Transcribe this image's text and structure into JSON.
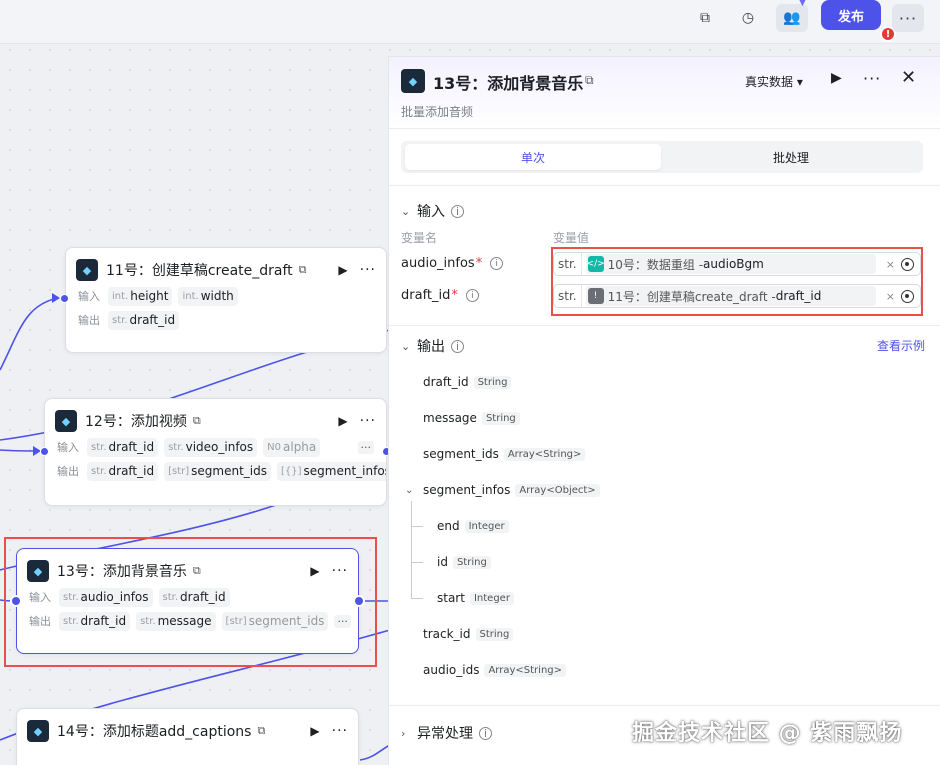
{
  "topbar": {
    "icons": [
      "layers-icon",
      "history-icon",
      "users-icon",
      "more-icon"
    ],
    "publish_label": "发布",
    "alert_label": "!"
  },
  "nodes": [
    {
      "title": "11号：创建草稿create_draft",
      "icon": "node-icon",
      "inputs_label": "输入",
      "outputs_label": "输出",
      "inputs": [
        {
          "type": "int.",
          "name": "height"
        },
        {
          "type": "int.",
          "name": "width"
        }
      ],
      "outputs": [
        {
          "type": "str.",
          "name": "draft_id"
        }
      ]
    },
    {
      "title": "12号：添加视频",
      "icon": "node-icon",
      "inputs_label": "输入",
      "outputs_label": "输出",
      "inputs": [
        {
          "type": "str.",
          "name": "draft_id"
        },
        {
          "type": "str.",
          "name": "video_infos"
        },
        {
          "type": "N0",
          "name": "alpha"
        }
      ],
      "more": "···",
      "outputs": [
        {
          "type": "str.",
          "name": "draft_id"
        },
        {
          "type": "[str]",
          "name": "segment_ids"
        },
        {
          "type": "[{}]",
          "name": "segment_infos"
        }
      ]
    },
    {
      "title": "13号：添加背景音乐",
      "icon": "node-icon",
      "inputs_label": "输入",
      "outputs_label": "输出",
      "inputs": [
        {
          "type": "str.",
          "name": "audio_infos"
        },
        {
          "type": "str.",
          "name": "draft_id"
        }
      ],
      "outputs": [
        {
          "type": "str.",
          "name": "draft_id"
        },
        {
          "type": "str.",
          "name": "message"
        },
        {
          "type": "[str]",
          "name": "segment_ids"
        }
      ],
      "more": "···"
    },
    {
      "title": "14号：添加标题add_captions",
      "icon": "node-icon"
    }
  ],
  "panel": {
    "title": "13号：添加背景音乐",
    "data_mode": "真实数据 ▾",
    "description": "批量添加音频",
    "tabs": [
      "单次",
      "批处理"
    ],
    "input_section": "输入",
    "col_var_name": "变量名",
    "col_var_value": "变量值",
    "inputs": [
      {
        "name": "audio_infos",
        "required": "*",
        "type": "str.",
        "ref_icon": "code-icon",
        "ref_color": "#14b8a6",
        "ref_source": "10号：数据重组 - ",
        "ref_var": "audioBgm"
      },
      {
        "name": "draft_id",
        "required": "*",
        "type": "str.",
        "ref_icon": "warning-icon",
        "ref_color": "#6b6e75",
        "ref_source": "11号：创建草稿create_draft - ",
        "ref_var": "draft_id"
      }
    ],
    "output_section": "输出",
    "view_example": "查看示例",
    "outputs": [
      {
        "name": "draft_id",
        "type": "String",
        "level": 0
      },
      {
        "name": "message",
        "type": "String",
        "level": 0
      },
      {
        "name": "segment_ids",
        "type": "Array<String>",
        "level": 0
      },
      {
        "name": "segment_infos",
        "type": "Array<Object>",
        "level": 0,
        "expanded": true
      },
      {
        "name": "end",
        "type": "Integer",
        "level": 1
      },
      {
        "name": "id",
        "type": "String",
        "level": 1
      },
      {
        "name": "start",
        "type": "Integer",
        "level": 1
      },
      {
        "name": "track_id",
        "type": "String",
        "level": 0
      },
      {
        "name": "audio_ids",
        "type": "Array<String>",
        "level": 0
      }
    ],
    "exception_section": "异常处理"
  },
  "watermark": "掘金技术社区 @ 紫雨飘扬",
  "colors": {
    "accent": "#4d53e8",
    "highlight": "#e8514a"
  }
}
